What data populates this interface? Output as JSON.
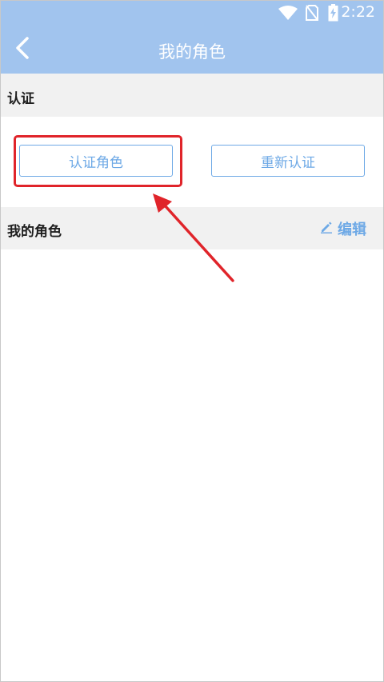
{
  "status_bar": {
    "time": "2:22",
    "icons": [
      "wifi-icon",
      "no-sim-icon",
      "battery-charging-icon"
    ]
  },
  "header": {
    "title": "我的角色",
    "back_icon": "chevron-left-icon",
    "background_color": "#a1c4ee"
  },
  "certification": {
    "section_title": "认证",
    "certify_button_label": "认证角色",
    "recertify_button_label": "重新认证"
  },
  "my_roles": {
    "section_title": "我的角色",
    "edit_label": "编辑",
    "edit_icon": "pencil-icon"
  },
  "annotation": {
    "highlight_color": "#e0242a"
  }
}
